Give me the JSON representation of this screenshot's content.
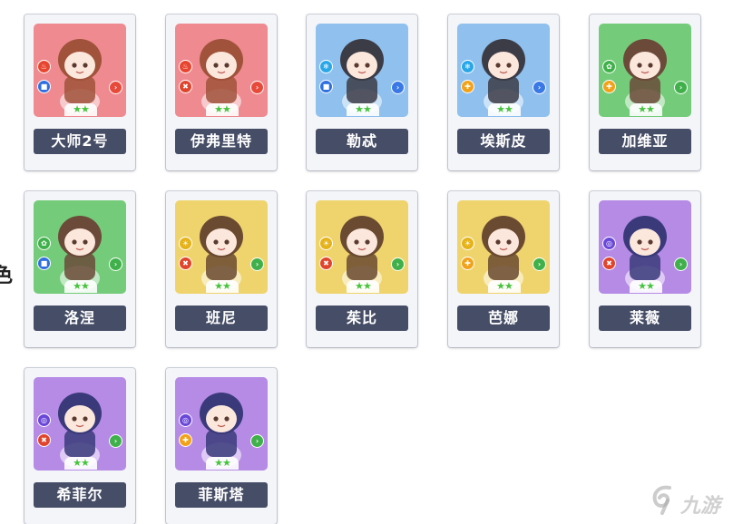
{
  "edge_text": "色",
  "characters": [
    {
      "name": "大师2号",
      "bg": "red",
      "element": "fire",
      "role": "shield",
      "stars": 2
    },
    {
      "name": "伊弗里特",
      "bg": "red",
      "element": "fire",
      "role": "wrench",
      "stars": 2
    },
    {
      "name": "勒忒",
      "bg": "blue",
      "element": "ice",
      "role": "shield",
      "stars": 2
    },
    {
      "name": "埃斯皮",
      "bg": "blue",
      "element": "ice",
      "role": "cross",
      "stars": 2
    },
    {
      "name": "加维亚",
      "bg": "green",
      "element": "nature",
      "role": "cross",
      "stars": 2
    },
    {
      "name": "洛涅",
      "bg": "green",
      "element": "nature",
      "role": "shield",
      "stars": 2
    },
    {
      "name": "班尼",
      "bg": "yellow",
      "element": "sun",
      "role": "wrench",
      "stars": 2
    },
    {
      "name": "茱比",
      "bg": "yellow",
      "element": "sun",
      "role": "wrench",
      "stars": 2
    },
    {
      "name": "芭娜",
      "bg": "yellow",
      "element": "sun",
      "role": "cross",
      "stars": 2
    },
    {
      "name": "莱薇",
      "bg": "purple",
      "element": "void",
      "role": "wrench",
      "stars": 2
    },
    {
      "name": "希菲尔",
      "bg": "purple",
      "element": "void",
      "role": "wrench",
      "stars": 2
    },
    {
      "name": "菲斯塔",
      "bg": "purple",
      "element": "void",
      "role": "cross",
      "stars": 2
    }
  ],
  "watermark": "九游",
  "colors": {
    "fire": "#e8452f",
    "ice": "#29a7e8",
    "nature": "#3fb04a",
    "sun": "#e5b21a",
    "void": "#6a47d8",
    "shield": "#2f6fe0",
    "wrench": "#e0442c",
    "cross": "#f2a21a",
    "arrow_red": "#e84a3a",
    "arrow_blue": "#3a78e6",
    "arrow_green": "#3fb04a",
    "plate": "#464d66",
    "star": "#46c43c"
  }
}
